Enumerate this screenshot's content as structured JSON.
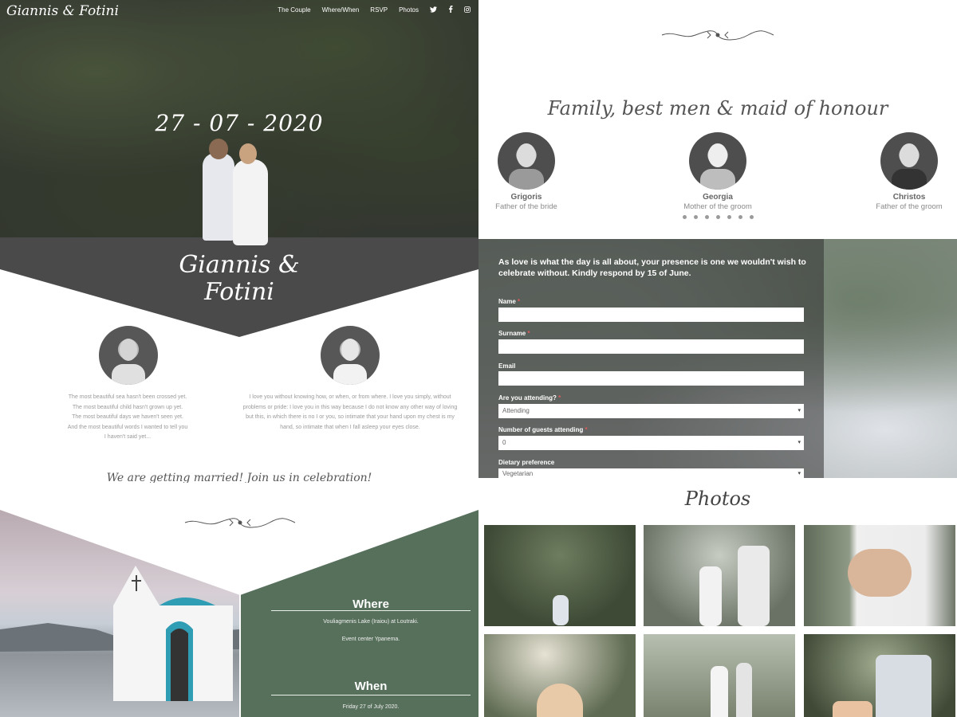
{
  "site": {
    "brand": "Giannis & Fotini",
    "nav": [
      "The Couple",
      "Where/When",
      "RSVP",
      "Photos"
    ],
    "social_icons": [
      "twitter-icon",
      "facebook-icon",
      "instagram-icon"
    ]
  },
  "hero": {
    "date": "27 - 07 - 2020",
    "names_line1": "Giannis &",
    "names_line2": "Fotini"
  },
  "couple": {
    "groom_quote": [
      "The most beautiful sea hasn't been crossed yet.",
      "The most beautiful child hasn't grown up yet.",
      "The most beautiful days we haven't seen yet.",
      "And the most beautiful words I wanted to tell you",
      "I haven't said yet..."
    ],
    "bride_quote": [
      "I love you without knowing how, or when, or from where. I love you simply, without",
      "problems or pride: I love you in this way because I do not know any other way of loving",
      "but this, in which there is no I or you, so intimate that your hand upon my chest is my",
      "hand, so intimate that when I fall asleep your eyes close."
    ],
    "tagline": "We are getting married! Join us in celebration!"
  },
  "where_when": {
    "where_title": "Where",
    "where_line1": "Vouliagmenis Lake (Iraiou) at Loutraki.",
    "where_line2": "Event center Ypanema.",
    "when_title": "When",
    "when_line1": "Friday 27 of July 2020."
  },
  "family": {
    "title": "Family, best men & maid of honour",
    "members": [
      {
        "name": "Grigoris",
        "role": "Father of the bride"
      },
      {
        "name": "Georgia",
        "role": "Mother of the groom"
      },
      {
        "name": "Christos",
        "role": "Father of the groom"
      }
    ],
    "carousel_dots": 7
  },
  "rsvp": {
    "intro": "As love is what the day is all about, your presence is one we wouldn't wish to celebrate without. Kindly respond by 15 of June.",
    "name_label": "Name",
    "surname_label": "Surname",
    "email_label": "Email",
    "attending_label": "Are you attending?",
    "attending_value": "Attending",
    "guests_label": "Number of guests attending",
    "guests_value": "0",
    "diet_label": "Dietary preference",
    "diet_value": "Vegetarian",
    "required_mark": "*"
  },
  "photos": {
    "title": "Photos"
  }
}
